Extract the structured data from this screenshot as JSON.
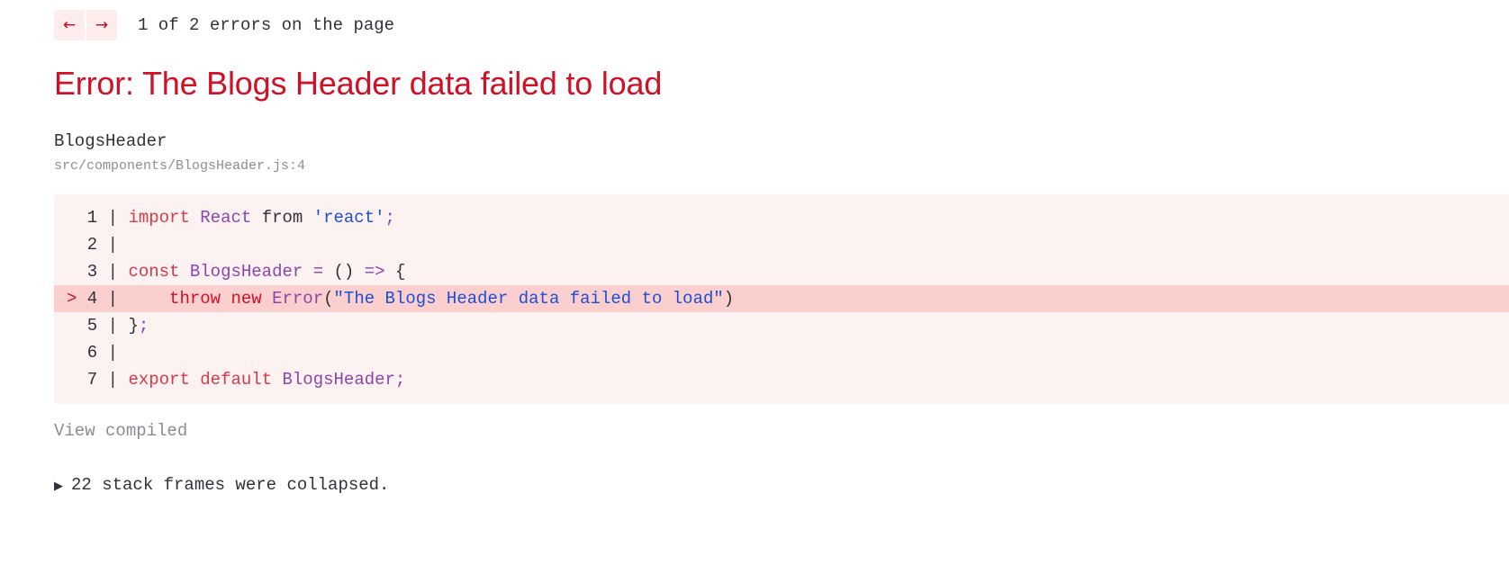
{
  "nav": {
    "prev_icon": "arrow-left-icon",
    "prev_label": "←",
    "next_icon": "arrow-right-icon",
    "next_label": "→",
    "counter": "1 of 2 errors on the page",
    "button_bg": "#fdeded",
    "arrow_color": "#d0021b"
  },
  "error": {
    "title": "Error: The Blogs Header data failed to load",
    "title_color": "#ce1126"
  },
  "frame": {
    "component": "BlogsHeader",
    "path": "src/components/BlogsHeader.js:4"
  },
  "code": {
    "background": "#fdf2f2",
    "highlight_background": "#fccfcf",
    "lines": [
      {
        "marker": " ",
        "number": "1",
        "bar": "|",
        "highlighted": false,
        "tokens": [
          {
            "text": " ",
            "type": "plain"
          },
          {
            "text": "import",
            "type": "kw"
          },
          {
            "text": " ",
            "type": "plain"
          },
          {
            "text": "React",
            "type": "id"
          },
          {
            "text": " ",
            "type": "plain"
          },
          {
            "text": "from",
            "type": "plain"
          },
          {
            "text": " ",
            "type": "plain"
          },
          {
            "text": "'react'",
            "type": "str"
          },
          {
            "text": ";",
            "type": "op"
          }
        ]
      },
      {
        "marker": " ",
        "number": "2",
        "bar": "|",
        "highlighted": false,
        "tokens": []
      },
      {
        "marker": " ",
        "number": "3",
        "bar": "|",
        "highlighted": false,
        "tokens": [
          {
            "text": " ",
            "type": "plain"
          },
          {
            "text": "const",
            "type": "kw"
          },
          {
            "text": " ",
            "type": "plain"
          },
          {
            "text": "BlogsHeader",
            "type": "id"
          },
          {
            "text": " ",
            "type": "plain"
          },
          {
            "text": "=",
            "type": "op"
          },
          {
            "text": " ",
            "type": "plain"
          },
          {
            "text": "()",
            "type": "punc"
          },
          {
            "text": " ",
            "type": "plain"
          },
          {
            "text": "=>",
            "type": "op"
          },
          {
            "text": " ",
            "type": "plain"
          },
          {
            "text": "{",
            "type": "punc"
          }
        ]
      },
      {
        "marker": ">",
        "number": "4",
        "bar": "|",
        "highlighted": true,
        "tokens": [
          {
            "text": "     ",
            "type": "plain"
          },
          {
            "text": "throw",
            "type": "kw2"
          },
          {
            "text": " ",
            "type": "plain"
          },
          {
            "text": "new",
            "type": "kw2"
          },
          {
            "text": " ",
            "type": "plain"
          },
          {
            "text": "Error",
            "type": "id"
          },
          {
            "text": "(",
            "type": "punc"
          },
          {
            "text": "\"The Blogs Header data failed to load\"",
            "type": "str"
          },
          {
            "text": ")",
            "type": "punc"
          }
        ]
      },
      {
        "marker": " ",
        "number": "5",
        "bar": "|",
        "highlighted": false,
        "tokens": [
          {
            "text": " ",
            "type": "plain"
          },
          {
            "text": "}",
            "type": "punc"
          },
          {
            "text": ";",
            "type": "op"
          }
        ]
      },
      {
        "marker": " ",
        "number": "6",
        "bar": "|",
        "highlighted": false,
        "tokens": []
      },
      {
        "marker": " ",
        "number": "7",
        "bar": "|",
        "highlighted": false,
        "tokens": [
          {
            "text": " ",
            "type": "plain"
          },
          {
            "text": "export",
            "type": "kw"
          },
          {
            "text": " ",
            "type": "plain"
          },
          {
            "text": "default",
            "type": "kw"
          },
          {
            "text": " ",
            "type": "plain"
          },
          {
            "text": "BlogsHeader",
            "type": "id"
          },
          {
            "text": ";",
            "type": "op"
          }
        ]
      }
    ]
  },
  "actions": {
    "view_compiled": "View compiled"
  },
  "collapsed": {
    "disclosure_icon": "triangle-right-icon",
    "disclosure_glyph": "▶",
    "text": "22 stack frames were collapsed."
  }
}
